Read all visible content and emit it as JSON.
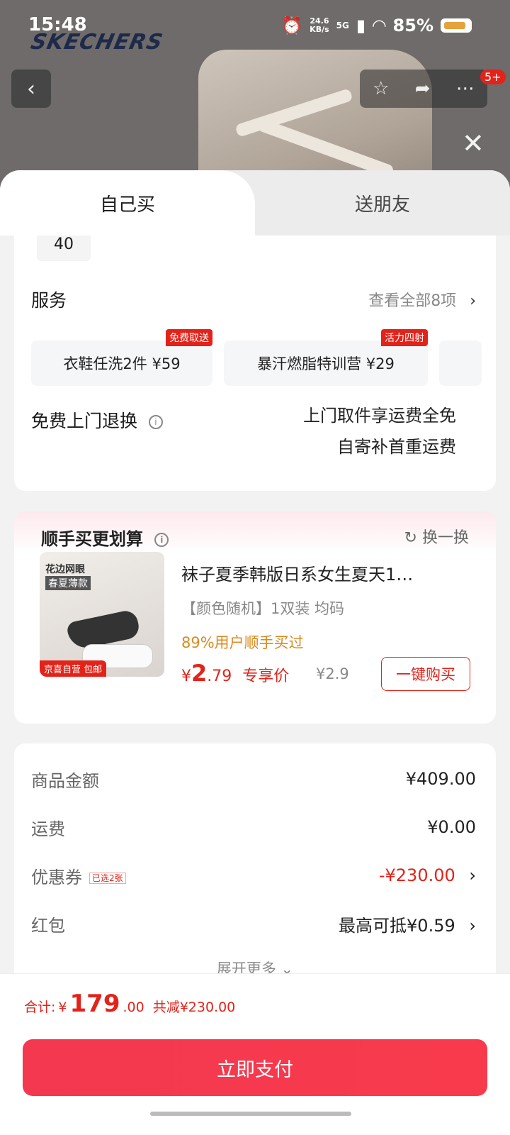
{
  "status_bar": {
    "time": "15:48",
    "speed_value": "24.6",
    "speed_unit": "KB/s",
    "network": "5G",
    "battery": "85%"
  },
  "brand_logo": "SKECHERS",
  "top_actions": {
    "badge": "5+"
  },
  "tabs": {
    "active": "自己买",
    "other": "送朋友"
  },
  "size": {
    "value": "40"
  },
  "service": {
    "title": "服务",
    "view_all": "查看全部8项",
    "items": [
      {
        "label": "衣鞋任洗2件  ¥59",
        "tag": "免费取送"
      },
      {
        "label": "暴汗燃脂特训营  ¥29",
        "tag": "活力四射"
      }
    ]
  },
  "return_policy": {
    "title": "免费上门退换",
    "line1": "上门取件享运费全免",
    "line2": "自寄补首重运费"
  },
  "addon": {
    "title": "顺手买更划算",
    "swap": "换一换",
    "product": {
      "image_text1": "花边网眼",
      "image_text2": "春夏薄款",
      "image_tag": "京喜自营 包邮",
      "name": "袜子夏季韩版日系女生夏天1…",
      "spec": "【颜色随机】1双装   均码",
      "stat": "89%用户顺手买过",
      "price_symbol": "¥",
      "price_int": "2",
      "price_dec": ".79",
      "price_label": "专享价",
      "orig_price": "¥2.9",
      "buy_label": "一键购买"
    }
  },
  "summary": {
    "goods_label": "商品金额",
    "goods_value": "¥409.00",
    "shipping_label": "运费",
    "shipping_value": "¥0.00",
    "coupon_label": "优惠券",
    "coupon_tag": "已选2张",
    "coupon_value": "-¥230.00",
    "redpack_label": "红包",
    "redpack_value": "最高可抵¥0.59",
    "expand": "展开更多"
  },
  "footer": {
    "total_label": "合计:",
    "total_symbol": "¥",
    "total_int": "179",
    "total_dec": ".00",
    "saved": "共减¥230.00",
    "pay_label": "立即支付"
  },
  "colors": {
    "accent": "#e2231a",
    "pay_button": "#f3384f",
    "orange": "#d98a1c"
  }
}
